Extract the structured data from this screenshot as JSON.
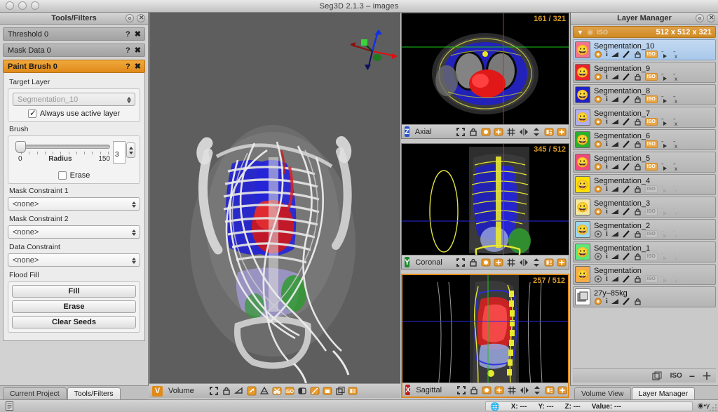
{
  "window": {
    "title": "Seg3D  2.1.3 – images"
  },
  "tools_panel": {
    "header": "Tools/Filters",
    "tools": [
      {
        "label": "Threshold 0",
        "active": false
      },
      {
        "label": "Mask Data 0",
        "active": false
      },
      {
        "label": "Paint Brush 0",
        "active": true
      }
    ],
    "help_glyph": "?",
    "close_glyph": "✖",
    "target_layer": {
      "group_label": "Target Layer",
      "value": "Segmentation_10",
      "checkbox_label": "Always use active layer",
      "checkbox_checked": true
    },
    "brush": {
      "group_label": "Brush",
      "min": "0",
      "max": "150",
      "name": "Radius",
      "value": "3",
      "erase_label": "Erase",
      "erase_checked": false
    },
    "mask_constraint_1": {
      "label": "Mask Constraint 1",
      "value": "<none>"
    },
    "mask_constraint_2": {
      "label": "Mask Constraint 2",
      "value": "<none>"
    },
    "data_constraint": {
      "label": "Data Constraint",
      "value": "<none>"
    },
    "flood_fill": {
      "label": "Flood Fill",
      "buttons": [
        "Fill",
        "Erase",
        "Clear Seeds"
      ]
    },
    "tabs": [
      {
        "label": "Current Project",
        "selected": false
      },
      {
        "label": "Tools/Filters",
        "selected": true
      }
    ]
  },
  "viewports": {
    "volume": {
      "tag": "V",
      "tag_color": "#e08a1a",
      "name": "Volume",
      "icons": [
        "fullscreen-icon",
        "lock-icon",
        "clipping-icon",
        "rotate-icon",
        "fog-icon",
        "scissors-icon",
        "iso-icon",
        "invert-icon",
        "slice-icon",
        "light-icon",
        "layers-icon",
        "picture-icon"
      ]
    },
    "axial": {
      "tag": "Z",
      "tag_color": "#2b56c8",
      "name": "Axial",
      "slice": "161 / 321",
      "icons": [
        "fullscreen-icon",
        "lock-icon",
        "color-icon",
        "overlay-icon",
        "grid-icon",
        "flip-horizontal-icon",
        "flip-vertical-icon",
        "picker-icon",
        "crosshair-icon"
      ]
    },
    "coronal": {
      "tag": "Y",
      "tag_color": "#1e8a2e",
      "name": "Coronal",
      "slice": "345 / 512",
      "icons": [
        "fullscreen-icon",
        "lock-icon",
        "color-icon",
        "overlay-icon",
        "grid-icon",
        "flip-horizontal-icon",
        "flip-vertical-icon",
        "picker-icon",
        "crosshair-icon"
      ]
    },
    "sagittal": {
      "tag": "X",
      "tag_color": "#c01f1f",
      "name": "Sagittal",
      "slice": "257 / 512",
      "icons": [
        "fullscreen-icon",
        "lock-icon",
        "color-icon",
        "overlay-icon",
        "grid-icon",
        "flip-horizontal-icon",
        "flip-vertical-icon",
        "picker-icon",
        "crosshair-icon"
      ]
    }
  },
  "layer_manager": {
    "header": "Layer Manager",
    "group": {
      "name": "ISO",
      "dimensions": "512 x 512 x 321",
      "expanded": true
    },
    "layers": [
      {
        "name": "Segmentation_10",
        "color": "#f4738c",
        "selected": true,
        "visible": true,
        "iso_on": true
      },
      {
        "name": "Segmentation_9",
        "color": "#e8242d",
        "selected": false,
        "visible": true,
        "iso_on": true
      },
      {
        "name": "Segmentation_8",
        "color": "#2020c8",
        "selected": false,
        "visible": true,
        "iso_on": true
      },
      {
        "name": "Segmentation_7",
        "color": "#b0b0f0",
        "selected": false,
        "visible": true,
        "iso_on": true
      },
      {
        "name": "Segmentation_6",
        "color": "#2ab02a",
        "selected": false,
        "visible": true,
        "iso_on": true
      },
      {
        "name": "Segmentation_5",
        "color": "#f04a7a",
        "selected": false,
        "visible": true,
        "iso_on": true
      },
      {
        "name": "Segmentation_4",
        "color": "#ffe000",
        "selected": false,
        "visible": true,
        "iso_on": false
      },
      {
        "name": "Segmentation_3",
        "color": "#f5e9a0",
        "selected": false,
        "visible": true,
        "iso_on": false
      },
      {
        "name": "Segmentation_2",
        "color": "#9bd8f0",
        "selected": false,
        "visible": false,
        "iso_on": false
      },
      {
        "name": "Segmentation_1",
        "color": "#5ce87a",
        "selected": false,
        "visible": false,
        "iso_on": false
      },
      {
        "name": "Segmentation",
        "color": "#f5ac4a",
        "selected": false,
        "visible": false,
        "iso_on": false
      },
      {
        "name": "27y–85kg",
        "color": "#ffffff",
        "selected": false,
        "visible": true,
        "iso_on": null,
        "is_data": true
      }
    ],
    "footer": {
      "iso_label": "ISO",
      "minus": "−",
      "plus": "＋"
    },
    "tabs": [
      {
        "label": "Volume View",
        "selected": false
      },
      {
        "label": "Layer Manager",
        "selected": true
      }
    ]
  },
  "statusbar": {
    "x_label": "X:",
    "x_value": "---",
    "y_label": "Y:",
    "y_value": "---",
    "z_label": "Z:",
    "z_value": "---",
    "value_label": "Value:",
    "value_value": "---"
  }
}
